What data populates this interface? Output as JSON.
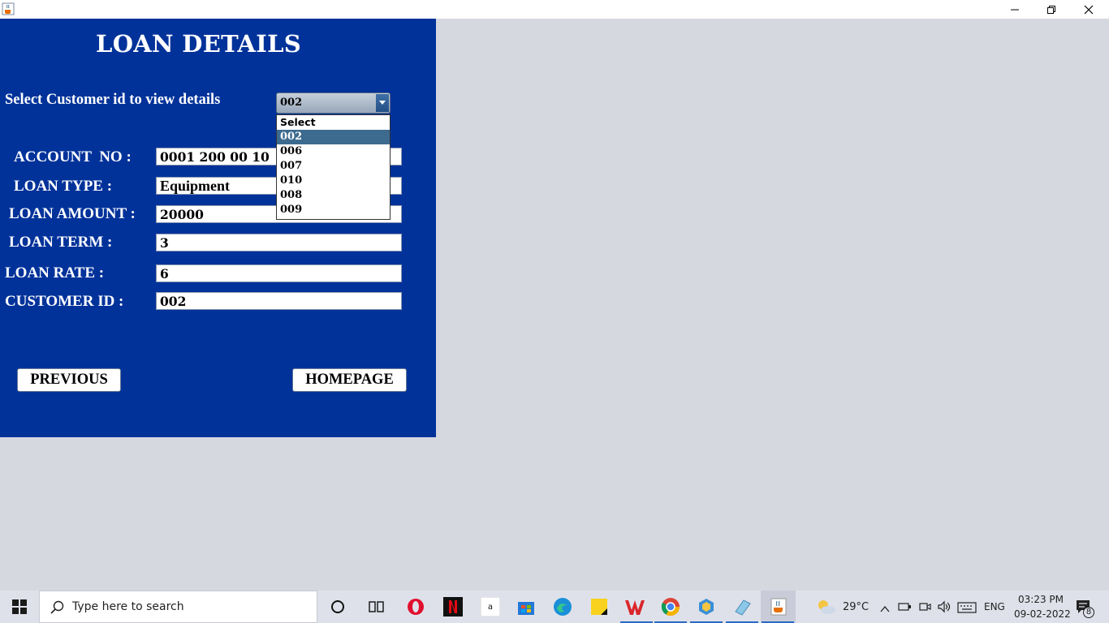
{
  "window": {
    "icon": "java-cup-icon",
    "controls": [
      "minimize",
      "restore",
      "close"
    ]
  },
  "panel": {
    "title": "LOAN DETAILS",
    "select_label": "Select Customer id to view details",
    "combo_value": "002",
    "fields": [
      {
        "label": "ACCOUNT  NO :",
        "value": "0001 200 00 10"
      },
      {
        "label": "LOAN TYPE :",
        "value": "Equipment"
      },
      {
        "label": "LOAN AMOUNT :",
        "value": "20000"
      },
      {
        "label": "LOAN TERM :",
        "value": "3"
      },
      {
        "label": "LOAN RATE :",
        "value": "6"
      },
      {
        "label": "CUSTOMER ID :",
        "value": "002"
      }
    ],
    "buttons": {
      "previous": "PREVIOUS",
      "homepage": "HOMEPAGE"
    },
    "dropdown_options": [
      "Select",
      "002",
      "006",
      "007",
      "010",
      "008",
      "009"
    ],
    "dropdown_selected": "002",
    "colors": {
      "panel_bg": "#00329a",
      "selected_option": "#3d6b8f"
    }
  },
  "taskbar": {
    "search_placeholder": "Type here to search",
    "weather": "29°C",
    "language": "ENG",
    "time": "03:23 PM",
    "date": "09-02-2022",
    "notifications": "8",
    "icons": [
      "cortana-icon",
      "task-view-icon",
      "opera-icon",
      "netflix-icon",
      "amazon-icon",
      "microsoft-store-icon",
      "edge-icon",
      "sticky-notes-icon",
      "wps-office-icon",
      "chrome-icon",
      "app-icon",
      "app-icon",
      "java-icon"
    ]
  }
}
